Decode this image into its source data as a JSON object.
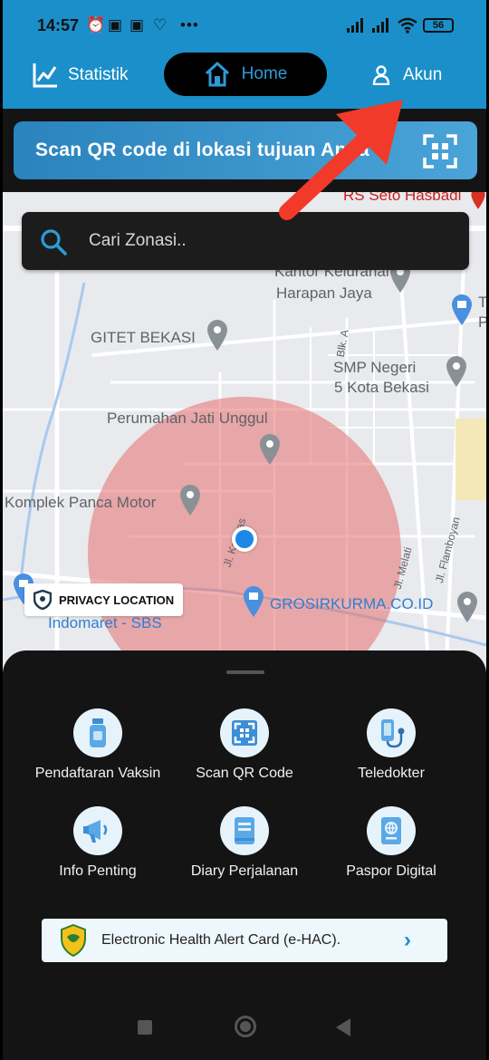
{
  "status_bar": {
    "time": "14:57",
    "battery": "56",
    "more_dots": "•••"
  },
  "nav": {
    "statistik_label": "Statistik",
    "home_label": "Home",
    "akun_label": "Akun"
  },
  "scan_banner": {
    "text": "Scan QR code di lokasi tujuan Anda",
    "arrow": "›"
  },
  "search": {
    "placeholder": "Cari Zonasi.."
  },
  "map": {
    "labels": {
      "rs_seto": "RS Seto Hasbadi",
      "kantor_1": "Kantor Kelurahan",
      "kantor_2": "Harapan Jaya",
      "gitet": "GITET BEKASI",
      "blk": "Blk. A",
      "smp_1": "SMP Negeri",
      "smp_2": "5 Kota Bekasi",
      "perumahan": "Perumahan Jati Unggul",
      "komplek": "Komplek Panca Motor",
      "kapuas": "Jl. Kapuas",
      "melati": "Jl. Melati",
      "flamboyan": "Jl. Flamboyan",
      "grosir": "GROSIRKURMA.CO.ID",
      "indomaret": "Indomaret - SBS",
      "t_edge": "T",
      "p_edge": "P"
    },
    "privacy_label": "PRIVACY LOCATION"
  },
  "menu": {
    "items": [
      {
        "label": "Pendaftaran Vaksin",
        "icon": "vaccine-bottle-icon"
      },
      {
        "label": "Scan QR Code",
        "icon": "qr-scan-icon"
      },
      {
        "label": "Teledokter",
        "icon": "stethoscope-phone-icon"
      },
      {
        "label": "Info Penting",
        "icon": "megaphone-icon"
      },
      {
        "label": "Diary Perjalanan",
        "icon": "diary-book-icon"
      },
      {
        "label": "Paspor Digital",
        "icon": "passport-icon"
      }
    ]
  },
  "ehac": {
    "label": "Electronic Health Alert Card (e-HAC).",
    "chevron": "›"
  },
  "colors": {
    "primary_blue": "#1b8fca",
    "sheet_dark": "#141414",
    "zone_red": "#e66e6e",
    "pointer_red": "#f23a2a"
  }
}
